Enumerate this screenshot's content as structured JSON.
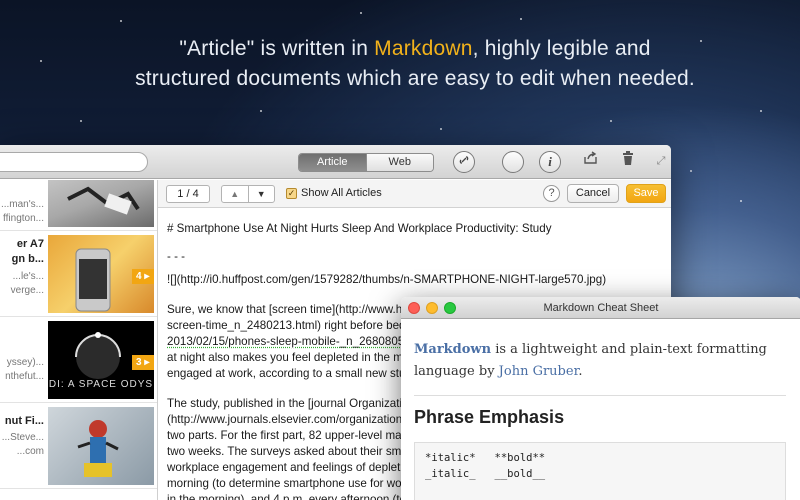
{
  "headline": {
    "part1": "\"Article\" is written in ",
    "highlight": "Markdown",
    "part2": ", highly legible and",
    "line2": "structured documents which are easy to edit when needed."
  },
  "toolbar": {
    "tab_article": "Article",
    "tab_web": "Web",
    "icons": [
      "link-icon",
      "compass-icon",
      "info-icon",
      "share-icon",
      "trash-icon",
      "fullscreen-icon"
    ]
  },
  "subbar": {
    "pager": "1 / 4",
    "checkbox_label": "Show All Articles",
    "checkbox_checked": true,
    "help": "?",
    "cancel": "Cancel",
    "save": "Save"
  },
  "list": [
    {
      "title": "",
      "sub1": "...man's...",
      "sub2": "ffington..."
    },
    {
      "title": "er A7",
      "title2": "gn b...",
      "sub1": "...le's...",
      "sub2": "verge...",
      "badge": "4"
    },
    {
      "title": "",
      "sub1": "yssey)...",
      "sub2": "nthefut...",
      "badge": "3",
      "thumb_text": "DI: A SPACE ODYS"
    },
    {
      "title": "nut Fi...",
      "sub1": "...Steve...",
      "sub2": "...com"
    }
  ],
  "editor": {
    "lines": [
      "# Smartphone Use At Night Hurts Sleep And Workplace Productivity: Study",
      "- - -",
      "![](http://i0.huffpost.com/gen/1579282/thumbs/n-SMARTPHONE-NIGHT-large570.jpg)",
      "Sure, we know that [screen time](http://www.h",
      "screen-time_n_2480213.html) right before bed",
      "2013/02/15/phones-sleep-mobile-_n_2680805",
      "at night also makes you feel depleted in the m",
      "engaged at work, according to a small new stu",
      "The study, published in the [journal Organizati",
      "(http://www.journals.elsevier.com/organization",
      "two parts. For the first part, 82 upper-level ma",
      "two weeks. The surveys asked about their sma",
      "workplace engagement and feelings of depleti",
      "morning (to determine smartphone use for wo",
      "in the morning), and 4 p.m. every afternoon (to"
    ]
  },
  "cheatsheet": {
    "window_title": "Markdown Cheat Sheet",
    "intro_link": "Markdown",
    "intro_text1": " is a lightweight and plain-text formatting",
    "intro_text2": "language by ",
    "intro_author": "John Gruber",
    "intro_end": ".",
    "heading": "Phrase Emphasis",
    "code_row1": "*italic*   **bold**",
    "code_row2": "_italic_   __bold__"
  },
  "colors": {
    "accent": "#f2a612",
    "link": "#4a6fa5"
  }
}
